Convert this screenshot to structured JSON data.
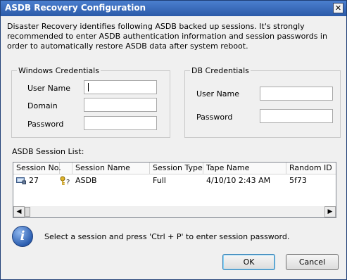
{
  "window": {
    "title": "ASDB Recovery Configuration",
    "close_glyph": "✕"
  },
  "description": "Disaster Recovery identifies following ASDB backed up sessions. It's strongly recommended to enter ASDB authentication information and session passwords in order to automatically restore ASDB data after system reboot.",
  "windows_credentials": {
    "legend": "Windows Credentials",
    "user_name_label": "User Name",
    "domain_label": "Domain",
    "password_label": "Password",
    "user_name_value": "",
    "domain_value": "",
    "password_value": ""
  },
  "db_credentials": {
    "legend": "DB Credentials",
    "user_name_label": "User Name",
    "password_label": "Password",
    "user_name_value": "",
    "password_value": ""
  },
  "session_list": {
    "label": "ASDB Session List:",
    "columns": [
      "Session No.",
      "",
      "Session Name",
      "Session Type",
      "Tape Name",
      "Random ID"
    ],
    "rows": [
      {
        "session_no": "27",
        "key_glyph": "🔑?",
        "session_name": "ASDB",
        "session_type": "Full",
        "tape_name": "4/10/10 2:43 AM",
        "random_id": "5f73"
      }
    ],
    "icons": {
      "row_icon": "tape-drive-icon",
      "key_icon": "key-question-icon"
    },
    "scroll_left": "◀",
    "scroll_right": "▶"
  },
  "info": {
    "icon_glyph": "i",
    "message": "Select a session and press 'Ctrl + P' to enter session password."
  },
  "buttons": {
    "ok": "OK",
    "cancel": "Cancel"
  },
  "colors": {
    "title_bar": "#2b5aa8",
    "background": "#f0f0f0",
    "default_button_border": "#3c7fb1"
  }
}
